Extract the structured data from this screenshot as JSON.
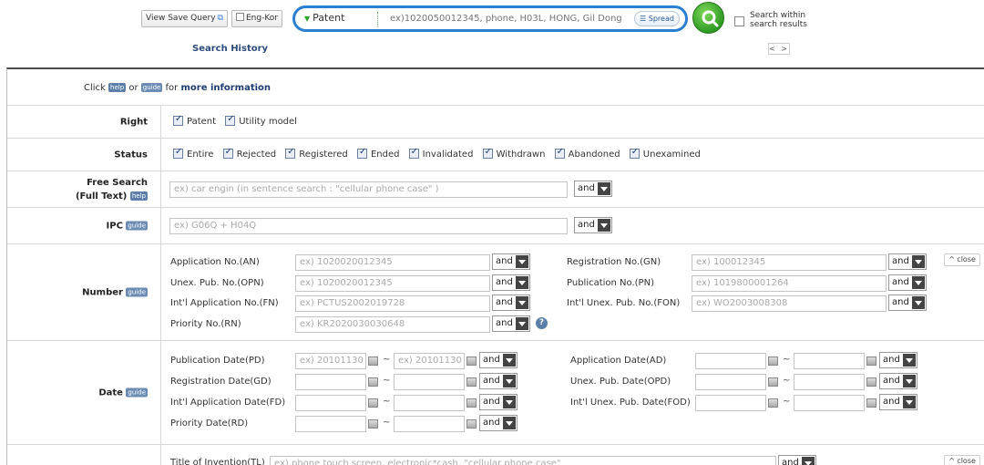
{
  "topbar": {
    "view_save_query": "View Save Query",
    "eng_kor": "Eng-Kor",
    "search_type": "Patent",
    "search_placeholder": "ex)1020050012345, phone, H03L, HONG, Gil Dong",
    "spread": "Spread",
    "search_within": "Search within search results",
    "search_history": "Search History",
    "pager": "< >"
  },
  "info": {
    "click": "Click",
    "or": "or",
    "for": "for",
    "more": "more information",
    "help": "help",
    "guide": "guide"
  },
  "right": {
    "label": "Right",
    "options": [
      "Patent",
      "Utility model"
    ]
  },
  "status": {
    "label": "Status",
    "options": [
      "Entire",
      "Rejected",
      "Registered",
      "Ended",
      "Invalidated",
      "Withdrawn",
      "Abandoned",
      "Unexamined"
    ]
  },
  "free_search": {
    "label1": "Free Search",
    "label2": "(Full Text)",
    "placeholder": "ex) car engin  (in sentence search : \"cellular phone case\" )",
    "op": "and"
  },
  "ipc": {
    "label": "IPC",
    "placeholder": "ex) G06Q + H04Q",
    "op": "and"
  },
  "number": {
    "label": "Number",
    "close": "close",
    "fields": [
      {
        "label": "Application No.(AN)",
        "placeholder": "ex) 1020020012345",
        "op": "and"
      },
      {
        "label": "Unex. Pub. No.(OPN)",
        "placeholder": "ex) 1020020012345",
        "op": "and"
      },
      {
        "label": "Int'l Application No.(FN)",
        "placeholder": "ex) PCTUS2002019728",
        "op": "and"
      },
      {
        "label": "Priority No.(RN)",
        "placeholder": "ex) KR2020030030648",
        "op": "and"
      },
      {
        "label": "Registration No.(GN)",
        "placeholder": "ex) 100012345",
        "op": "and"
      },
      {
        "label": "Publication No.(PN)",
        "placeholder": "ex) 1019800001264",
        "op": "and"
      },
      {
        "label": "Int'l Unex. Pub. No.(FON)",
        "placeholder": "ex) WO2003008308",
        "op": "and"
      }
    ]
  },
  "date": {
    "label": "Date",
    "fields": [
      {
        "label": "Publication Date(PD)",
        "from": "ex) 20101130",
        "to": "ex) 20101130",
        "op": "and"
      },
      {
        "label": "Registration Date(GD)",
        "from": "",
        "to": "",
        "op": "and"
      },
      {
        "label": "Int'l Application Date(FD)",
        "from": "",
        "to": "",
        "op": "and"
      },
      {
        "label": "Priority Date(RD)",
        "from": "",
        "to": "",
        "op": "and"
      },
      {
        "label": "Application Date(AD)",
        "from": "",
        "to": "",
        "op": "and"
      },
      {
        "label": "Unex. Pub. Date(OPD)",
        "from": "",
        "to": "",
        "op": "and"
      },
      {
        "label": "Int'l Unex. Pub. Date(FOD)",
        "from": "",
        "to": "",
        "op": "and"
      }
    ]
  },
  "title": {
    "label": "Title of Invention(TL)",
    "placeholder": "ex) phone touch screen, electronic*cash, \"cellular phone case\"",
    "op": "and",
    "close": "close"
  }
}
